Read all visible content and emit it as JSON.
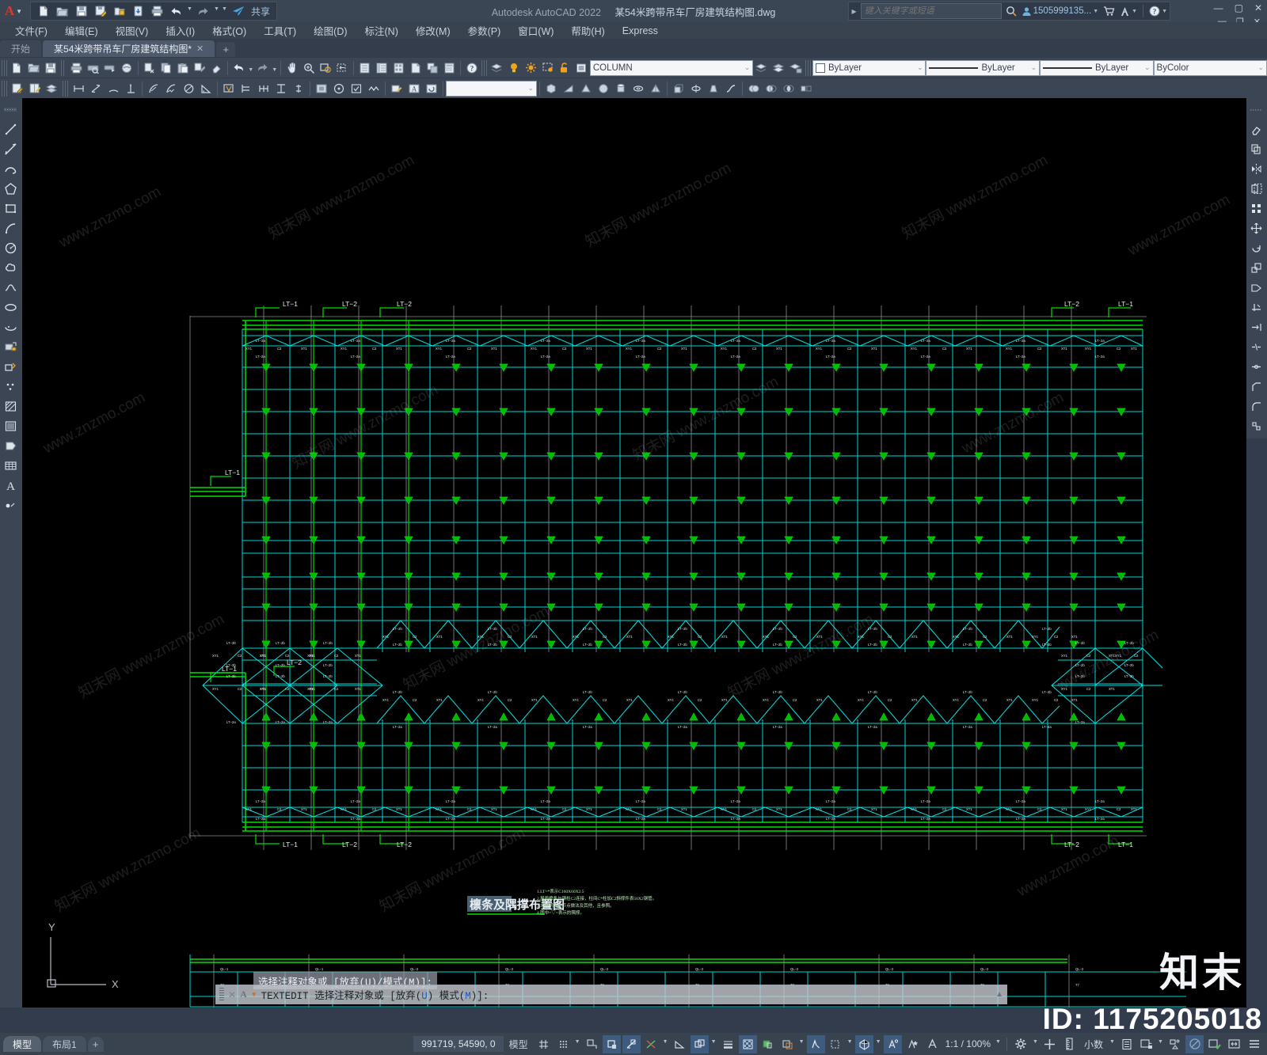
{
  "titlebar": {
    "app_letter": "A",
    "product_title": "Autodesk AutoCAD 2022",
    "file_title": "某54米跨带吊车厂房建筑结构图.dwg",
    "share_label": "共享",
    "search_placeholder": "键入关键字或短语",
    "account_name": "1505999135...",
    "quick_access": [
      {
        "name": "new-file-icon",
        "glyph": "new"
      },
      {
        "name": "open-file-icon",
        "glyph": "open"
      },
      {
        "name": "save-icon",
        "glyph": "save"
      },
      {
        "name": "save-as-icon",
        "glyph": "saveas"
      },
      {
        "name": "save-to-web-icon",
        "glyph": "webfolder"
      },
      {
        "name": "open-from-web-icon",
        "glyph": "webopen"
      },
      {
        "name": "plot-icon",
        "glyph": "print"
      },
      {
        "name": "undo-icon",
        "glyph": "undo"
      },
      {
        "name": "redo-icon",
        "glyph": "redo"
      },
      {
        "name": "share-icon",
        "glyph": "share"
      }
    ]
  },
  "menu": {
    "items": [
      {
        "label": "文件(F)",
        "name": "menu-file"
      },
      {
        "label": "编辑(E)",
        "name": "menu-edit"
      },
      {
        "label": "视图(V)",
        "name": "menu-view"
      },
      {
        "label": "插入(I)",
        "name": "menu-insert"
      },
      {
        "label": "格式(O)",
        "name": "menu-format"
      },
      {
        "label": "工具(T)",
        "name": "menu-tools"
      },
      {
        "label": "绘图(D)",
        "name": "menu-draw"
      },
      {
        "label": "标注(N)",
        "name": "menu-dimension"
      },
      {
        "label": "修改(M)",
        "name": "menu-modify"
      },
      {
        "label": "参数(P)",
        "name": "menu-parametric"
      },
      {
        "label": "窗口(W)",
        "name": "menu-window"
      },
      {
        "label": "帮助(H)",
        "name": "menu-help"
      },
      {
        "label": "Express",
        "name": "menu-express"
      }
    ]
  },
  "tabs": {
    "start_label": "开始",
    "file_label": "某54米跨带吊车厂房建筑结构图*",
    "close_glyph": "✕",
    "add_glyph": "+"
  },
  "properties": {
    "layer_name": "COLUMN",
    "color": "ByLayer",
    "linetype": "ByLayer",
    "lineweight": "ByLayer",
    "plotstyle": "ByColor"
  },
  "command": {
    "prompt_a": "A",
    "active_command": "TEXTEDIT",
    "prompt_text": "选择注释对象或",
    "prompt_options_pre": "[放弃(",
    "prompt_opt_u": "U",
    "prompt_mid": ") 模式(",
    "prompt_opt_m": "M",
    "prompt_options_post": ")]:",
    "tooltip_text": "选择注释对象或 [放弃(U)/模式(M)]:"
  },
  "statusbar": {
    "model_tab": "模型",
    "layout_tab": "布局1",
    "add_layout": "+",
    "coordinates": "991719, 54590, 0",
    "space_label": "模型",
    "scale_label": "1:1 / 100%",
    "units_label": "小数",
    "buttons": [
      {
        "name": "grid-display-toggle",
        "glyph": "grid",
        "state": "off"
      },
      {
        "name": "snap-mode-toggle",
        "glyph": "snapdots",
        "state": "off"
      },
      {
        "name": "ortho-mode-toggle",
        "glyph": "ortho",
        "state": "off"
      },
      {
        "name": "object-snap-toggle",
        "glyph": "osnap",
        "state": "on"
      },
      {
        "name": "polar-tracking-toggle",
        "glyph": "polar",
        "state": "on"
      },
      {
        "name": "otrack-toggle",
        "glyph": "otrack",
        "state": "off"
      },
      {
        "name": "dynamic-ucs-toggle",
        "glyph": "ucs",
        "state": "off"
      },
      {
        "name": "lineweight-toggle",
        "glyph": "lineweight",
        "state": "off"
      },
      {
        "name": "transparency-toggle",
        "glyph": "transparency",
        "state": "on"
      },
      {
        "name": "selection-cycling-toggle",
        "glyph": "cycling",
        "state": "off"
      },
      {
        "name": "3d-object-snap-toggle",
        "glyph": "snap3d",
        "state": "on"
      },
      {
        "name": "dynamic-input-toggle",
        "glyph": "dyninput",
        "state": "off"
      },
      {
        "name": "annotation-visibility-toggle",
        "glyph": "annovis",
        "state": "on"
      },
      {
        "name": "autoscale-toggle",
        "glyph": "autoscale",
        "state": "off"
      },
      {
        "name": "annotation-scale-icon",
        "glyph": "annoscale",
        "state": "off"
      },
      {
        "name": "workspace-gear-icon",
        "glyph": "gear",
        "state": "off"
      },
      {
        "name": "customization-icon",
        "glyph": "plus",
        "state": "off"
      },
      {
        "name": "units-ruler-icon",
        "glyph": "ruler",
        "state": "off"
      },
      {
        "name": "quickprops-icon",
        "glyph": "quickprops",
        "state": "off"
      },
      {
        "name": "isolate-objects-icon",
        "glyph": "isolate",
        "state": "off"
      },
      {
        "name": "hardware-accel-icon",
        "glyph": "hardware",
        "state": "off"
      },
      {
        "name": "clean-screen-icon",
        "glyph": "cleanscreen",
        "state": "on"
      },
      {
        "name": "fullscreen-icon",
        "glyph": "fullscreen",
        "state": "off"
      },
      {
        "name": "statusbar-menu-icon",
        "glyph": "hamburger",
        "state": "off"
      }
    ]
  },
  "ucs": {
    "x_label": "X",
    "y_label": "Y"
  },
  "watermarks": {
    "tiles": [
      "知末网 www.znzmo.com",
      "www.znzmo.com",
      "知末网",
      "www.znzmo.com"
    ],
    "brand": "知末",
    "id_text": "ID: 1175205018"
  },
  "drawing": {
    "title_text": "檩条及隅撑布置图",
    "note_lines": [
      "1.LT=*表示C160X60X2.5",
      "2.屋面檩条与钢柱C2连接，柱间C*柱加C2斜撑件表50X2钢管。",
      "3.未注明钢架节点做法及其他，且参照。",
      "4.图中=▽=表示的隅撑。"
    ],
    "labels_top": [
      "LT−1",
      "LT−2",
      "LT−2",
      "LT−2",
      "LT−1"
    ],
    "labels_left": [
      "LT−1",
      "LT−2",
      "LT−1"
    ],
    "node_tag": "LT−2a",
    "member_tags": [
      "XY1",
      "C2",
      "XT1"
    ],
    "colors": {
      "purlin_green": "#00d800",
      "frame_cyan": "#00e5e5",
      "grid_gray": "#9a9a9a",
      "background": "#000000"
    },
    "bay_count": 18,
    "row_count": 16
  }
}
